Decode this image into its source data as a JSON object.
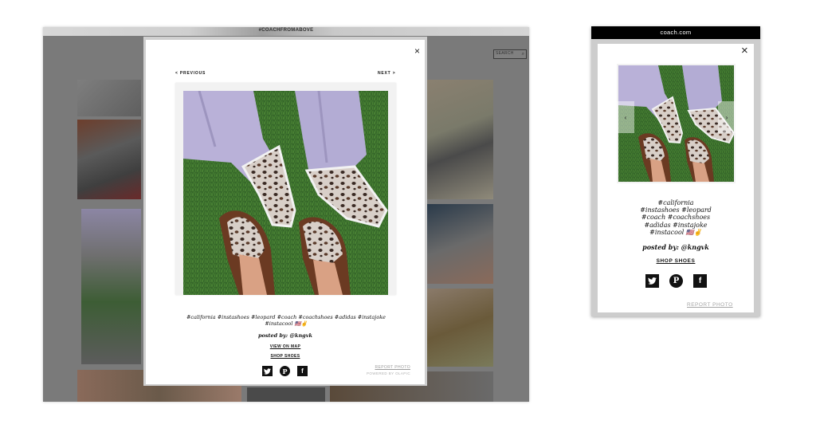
{
  "desktop": {
    "header_title": "#COACHFROMABOVE",
    "search_label": "SEARCH",
    "modal": {
      "prev_label": "< PREVIOUS",
      "next_label": "NEXT >",
      "close_icon": "close-icon",
      "tags": "#california #instashoes #leopard #coach #coachshoes #adidas #instajoke #instacool 🇺🇸✌",
      "posted_by": "posted by: @kngvk",
      "view_on_map": "VIEW ON MAP",
      "shop_shoes": "SHOP SHOES",
      "report_photo": "REPORT PHOTO",
      "powered_by": "POWERED BY OLAPIC"
    },
    "social_icons": [
      "twitter-icon",
      "pinterest-icon",
      "facebook-icon"
    ],
    "colors": {
      "overlay": "#7a7a7a",
      "modal_bg": "#ffffff",
      "grass": "#3a6b2a",
      "denim": "#b7afd6"
    }
  },
  "mobile": {
    "url": "coach.com",
    "tags": [
      "#california",
      "#instashoes #leopard",
      "#coach #coachshoes",
      "#adidas #instajoke",
      "#instacool 🇺🇸✌"
    ],
    "posted_by": "posted by: @kngvk",
    "shop_shoes": "SHOP SHOES",
    "report_photo": "REPORT PHOTO",
    "prev_arrow": "‹",
    "next_arrow": "›"
  }
}
